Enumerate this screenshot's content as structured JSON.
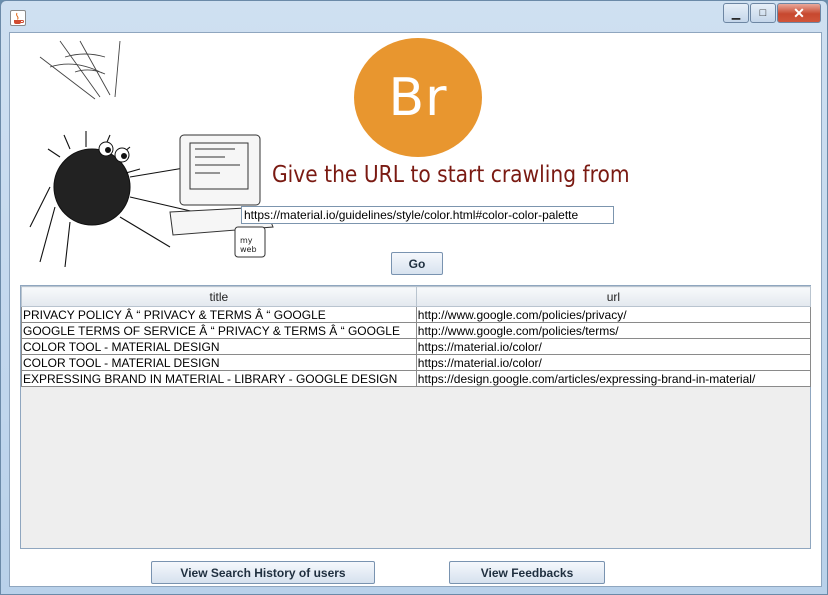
{
  "window": {
    "controls": {
      "minimize": "▁",
      "maximize": "□",
      "close": "✕"
    }
  },
  "logo": {
    "text": "Br",
    "color": "#e8962f"
  },
  "headline": "Give the URL to start crawling from",
  "url_input": {
    "value": "https://material.io/guidelines/style/color.html#color-color-palette"
  },
  "go_button": "Go",
  "table": {
    "headers": [
      "title",
      "url"
    ],
    "rows": [
      [
        "PRIVACY POLICY Â  “ PRIVACY & TERMS Â  “ GOOGLE",
        "http://www.google.com/policies/privacy/"
      ],
      [
        "GOOGLE TERMS OF SERVICE Â  “ PRIVACY & TERMS Â  “ GOOGLE",
        "http://www.google.com/policies/terms/"
      ],
      [
        "COLOR TOOL - MATERIAL DESIGN",
        "https://material.io/color/"
      ],
      [
        "COLOR TOOL - MATERIAL DESIGN",
        "https://material.io/color/"
      ],
      [
        "EXPRESSING BRAND IN MATERIAL - LIBRARY - GOOGLE DESIGN",
        "https://design.google.com/articles/expressing-brand-in-material/"
      ]
    ]
  },
  "buttons": {
    "history": "View Search History of users",
    "feedback": "View Feedbacks"
  },
  "icons": {
    "app": "java-coffee-icon",
    "illustration": "spider-computer-illustration"
  }
}
